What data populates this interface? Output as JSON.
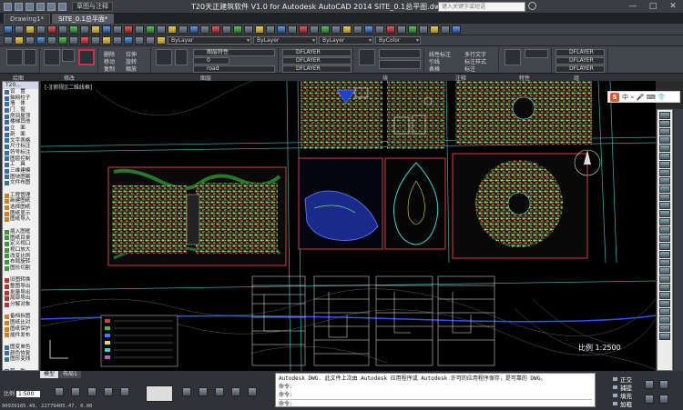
{
  "window": {
    "title": "T20天正建筑软件 V1.0 for Autodesk AutoCAD 2014      SITE_0.1总平图.dwg",
    "workspace": "草图与注释",
    "search_placeholder": "键入关键字或短语",
    "controls": [
      "—",
      "□",
      "✕"
    ]
  },
  "doc_tabs": [
    {
      "label": "Drawing1*"
    },
    {
      "label": "SITE_0.1总平面*"
    }
  ],
  "toolbar2": {
    "layer_combo": "ByLayer",
    "linetype_combo": "ByLayer",
    "lineweight_combo": "ByLayer",
    "plotstyle_combo": "ByColor"
  },
  "ribbon": {
    "layer_panel": {
      "rows": [
        "DFLAYER",
        "DFLAYER",
        "DFLAYER"
      ],
      "current_layer": "0",
      "layer_name": "road",
      "label_match": "图层特性"
    },
    "draw_panel": {
      "items": [
        "删除",
        "移动",
        "复制",
        "拉伸",
        "旋转",
        "缩放"
      ]
    },
    "annotate_panel": {
      "items": [
        "线性标注",
        "引线",
        "表格",
        "多行文字",
        "标注样式",
        "标注"
      ]
    },
    "panel_labels": [
      "绘图",
      "修改",
      "图层",
      "注释",
      "块",
      "特性",
      "组"
    ]
  },
  "left_panel": {
    "header": "T20...",
    "items": [
      {
        "label": "设　置",
        "c": ""
      },
      {
        "label": "轴网柱子",
        "c": ""
      },
      {
        "label": "墙　体",
        "c": ""
      },
      {
        "label": "门　窗",
        "c": ""
      },
      {
        "label": "房间屋顶",
        "c": ""
      },
      {
        "label": "楼梯其他",
        "c": ""
      },
      {
        "label": "立　面",
        "c": ""
      },
      {
        "label": "剖　面",
        "c": ""
      },
      {
        "label": "文字表格",
        "c": ""
      },
      {
        "label": "尺寸标注",
        "c": ""
      },
      {
        "label": "符号标注",
        "c": ""
      },
      {
        "label": "图层控制",
        "c": ""
      },
      {
        "label": "工　具",
        "c": ""
      },
      {
        "label": "三维建模",
        "c": ""
      },
      {
        "label": "图块图案",
        "c": ""
      },
      {
        "label": "文件布图",
        "c": ""
      },
      {
        "label": "",
        "c": ""
      },
      {
        "label": "工程管理",
        "c": "o"
      },
      {
        "label": "新建图纸",
        "c": "o"
      },
      {
        "label": "选择图纸",
        "c": "o"
      },
      {
        "label": "图纸显示",
        "c": "o"
      },
      {
        "label": "图纸导入",
        "c": "o"
      },
      {
        "label": "",
        "c": ""
      },
      {
        "label": "插入图框",
        "c": "g"
      },
      {
        "label": "图纸目录",
        "c": "g"
      },
      {
        "label": "定义视口",
        "c": "g"
      },
      {
        "label": "视口放大",
        "c": "g"
      },
      {
        "label": "改变比例",
        "c": "g"
      },
      {
        "label": "布局旋转",
        "c": "g"
      },
      {
        "label": "图形切割",
        "c": "g"
      },
      {
        "label": "",
        "c": ""
      },
      {
        "label": "旧图转换",
        "c": "r"
      },
      {
        "label": "整图导出",
        "c": "r"
      },
      {
        "label": "批量导出",
        "c": "r"
      },
      {
        "label": "局部导出",
        "c": "r"
      },
      {
        "label": "分解对象",
        "c": "r"
      },
      {
        "label": "",
        "c": ""
      },
      {
        "label": "备档拆图",
        "c": "o"
      },
      {
        "label": "图纸比对",
        "c": "o"
      },
      {
        "label": "图纸保护",
        "c": "o"
      },
      {
        "label": "插件发布",
        "c": "o"
      },
      {
        "label": "",
        "c": ""
      },
      {
        "label": "图变单色",
        "c": ""
      },
      {
        "label": "颜色恢复",
        "c": ""
      },
      {
        "label": "图形变线",
        "c": ""
      },
      {
        "label": "",
        "c": ""
      },
      {
        "label": "帮　助",
        "c": ""
      }
    ]
  },
  "viewport": {
    "label": "[-][俯视][二维线框]",
    "scale_text": "比例 1:2500"
  },
  "ime": {
    "logo": "S",
    "text": "中 ∘ 🎤 ⌨ 👕"
  },
  "layout_tabs": [
    {
      "label": "模型",
      "active": true
    },
    {
      "label": "布局1",
      "active": false
    }
  ],
  "status": {
    "scale_label": "比例",
    "scale_value": "1:500",
    "coords": "90939185.49, 22779405.47, 0.00",
    "toggles": [
      "正交",
      "捕提",
      "填充",
      "加粗"
    ]
  },
  "command": {
    "history": [
      "Autodesk DWG.  此文件上次由 Autodesk 应用程序或 Autodesk 许可的应用程序保存，是可靠的 DWG。",
      "命令:",
      "命令:"
    ],
    "prompt": "命令:"
  }
}
